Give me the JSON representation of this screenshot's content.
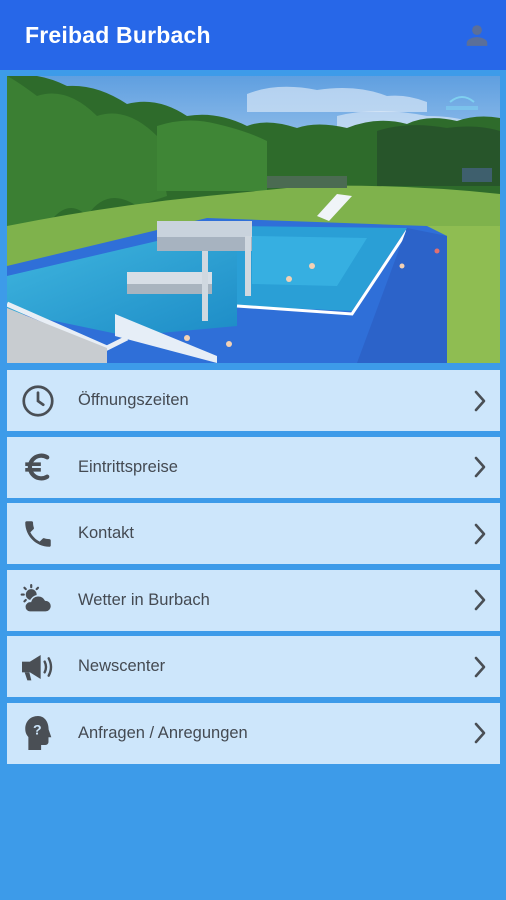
{
  "appbar": {
    "title": "Freibad Burbach",
    "account_icon": "person-icon"
  },
  "hero": {
    "description_icon": "pool-photo"
  },
  "menu": {
    "items": [
      {
        "label": "Öffnungszeiten",
        "icon": "clock-icon"
      },
      {
        "label": "Eintrittspreise",
        "icon": "euro-icon"
      },
      {
        "label": "Kontakt",
        "icon": "phone-icon"
      },
      {
        "label": "Wetter in Burbach",
        "icon": "weather-icon"
      },
      {
        "label": "Newscenter",
        "icon": "megaphone-icon"
      },
      {
        "label": "Anfragen / Anregungen",
        "icon": "head-question-icon"
      }
    ]
  },
  "colors": {
    "appbar": "#2767e8",
    "background": "#3d9be9",
    "item_background": "#cde6fb",
    "icon": "#4a4f55"
  }
}
